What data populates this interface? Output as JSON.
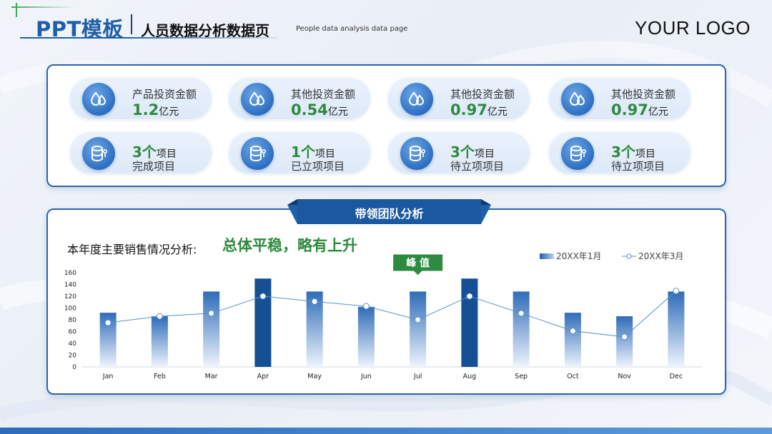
{
  "header": {
    "brand_title": "PPT模板",
    "page_title": "人员数据分析数据页",
    "page_subtitle": "People data analysis data page",
    "logo": "YOUR LOGO"
  },
  "investments": [
    {
      "label": "产品投资金额",
      "value": "1.2",
      "unit": "亿元",
      "icon": "water-drop-icon"
    },
    {
      "label": "其他投资金额",
      "value": "0.54",
      "unit": "亿元",
      "icon": "water-drop-icon"
    },
    {
      "label": "其他投资金额",
      "value": "0.97",
      "unit": "亿元",
      "icon": "water-drop-icon"
    },
    {
      "label": "其他投资金额",
      "value": "0.97",
      "unit": "亿元",
      "icon": "water-drop-icon"
    }
  ],
  "projects": [
    {
      "count": "3个",
      "unit": "项目",
      "label": "完成项目",
      "icon": "database-icon"
    },
    {
      "count": "1个",
      "unit": "项目",
      "label": "已立项项目",
      "icon": "database-icon"
    },
    {
      "count": "3个",
      "unit": "项目",
      "label": "待立项项目",
      "icon": "database-icon"
    },
    {
      "count": "3个",
      "unit": "项目",
      "label": "待立项项目",
      "icon": "database-icon"
    }
  ],
  "team_section": {
    "ribbon_title": "带领团队分析",
    "analysis_label": "本年度主要销售情况分析:",
    "analysis_highlight": "总体平稳，略有上升",
    "peak_label": "峰 值"
  },
  "colors": {
    "primary": "#1f5fa8",
    "accent_green": "#2e8a3e",
    "dark_bar": "#154f94",
    "line": "#5a8fcf"
  },
  "chart_data": {
    "type": "bar",
    "categories": [
      "Jan",
      "Feb",
      "Mar",
      "Apr",
      "May",
      "Jun",
      "Jul",
      "Aug",
      "Sep",
      "Oct",
      "Nov",
      "Dec"
    ],
    "series": [
      {
        "name": "20XX年1月",
        "type": "bar",
        "values": [
          92,
          86,
          128,
          150,
          128,
          102,
          128,
          150,
          128,
          92,
          86,
          128
        ],
        "highlight": [
          false,
          false,
          false,
          true,
          false,
          false,
          false,
          true,
          false,
          false,
          false,
          false
        ]
      },
      {
        "name": "20XX年3月",
        "type": "line",
        "values": [
          75,
          86,
          91,
          120,
          111,
          103,
          80,
          120,
          91,
          61,
          51,
          129
        ]
      }
    ],
    "yticks": [
      0,
      20,
      40,
      60,
      80,
      100,
      120,
      140,
      160
    ],
    "ylim": [
      0,
      160
    ],
    "peak_category": "Jul",
    "legend_position": "top-right",
    "grid": false
  }
}
